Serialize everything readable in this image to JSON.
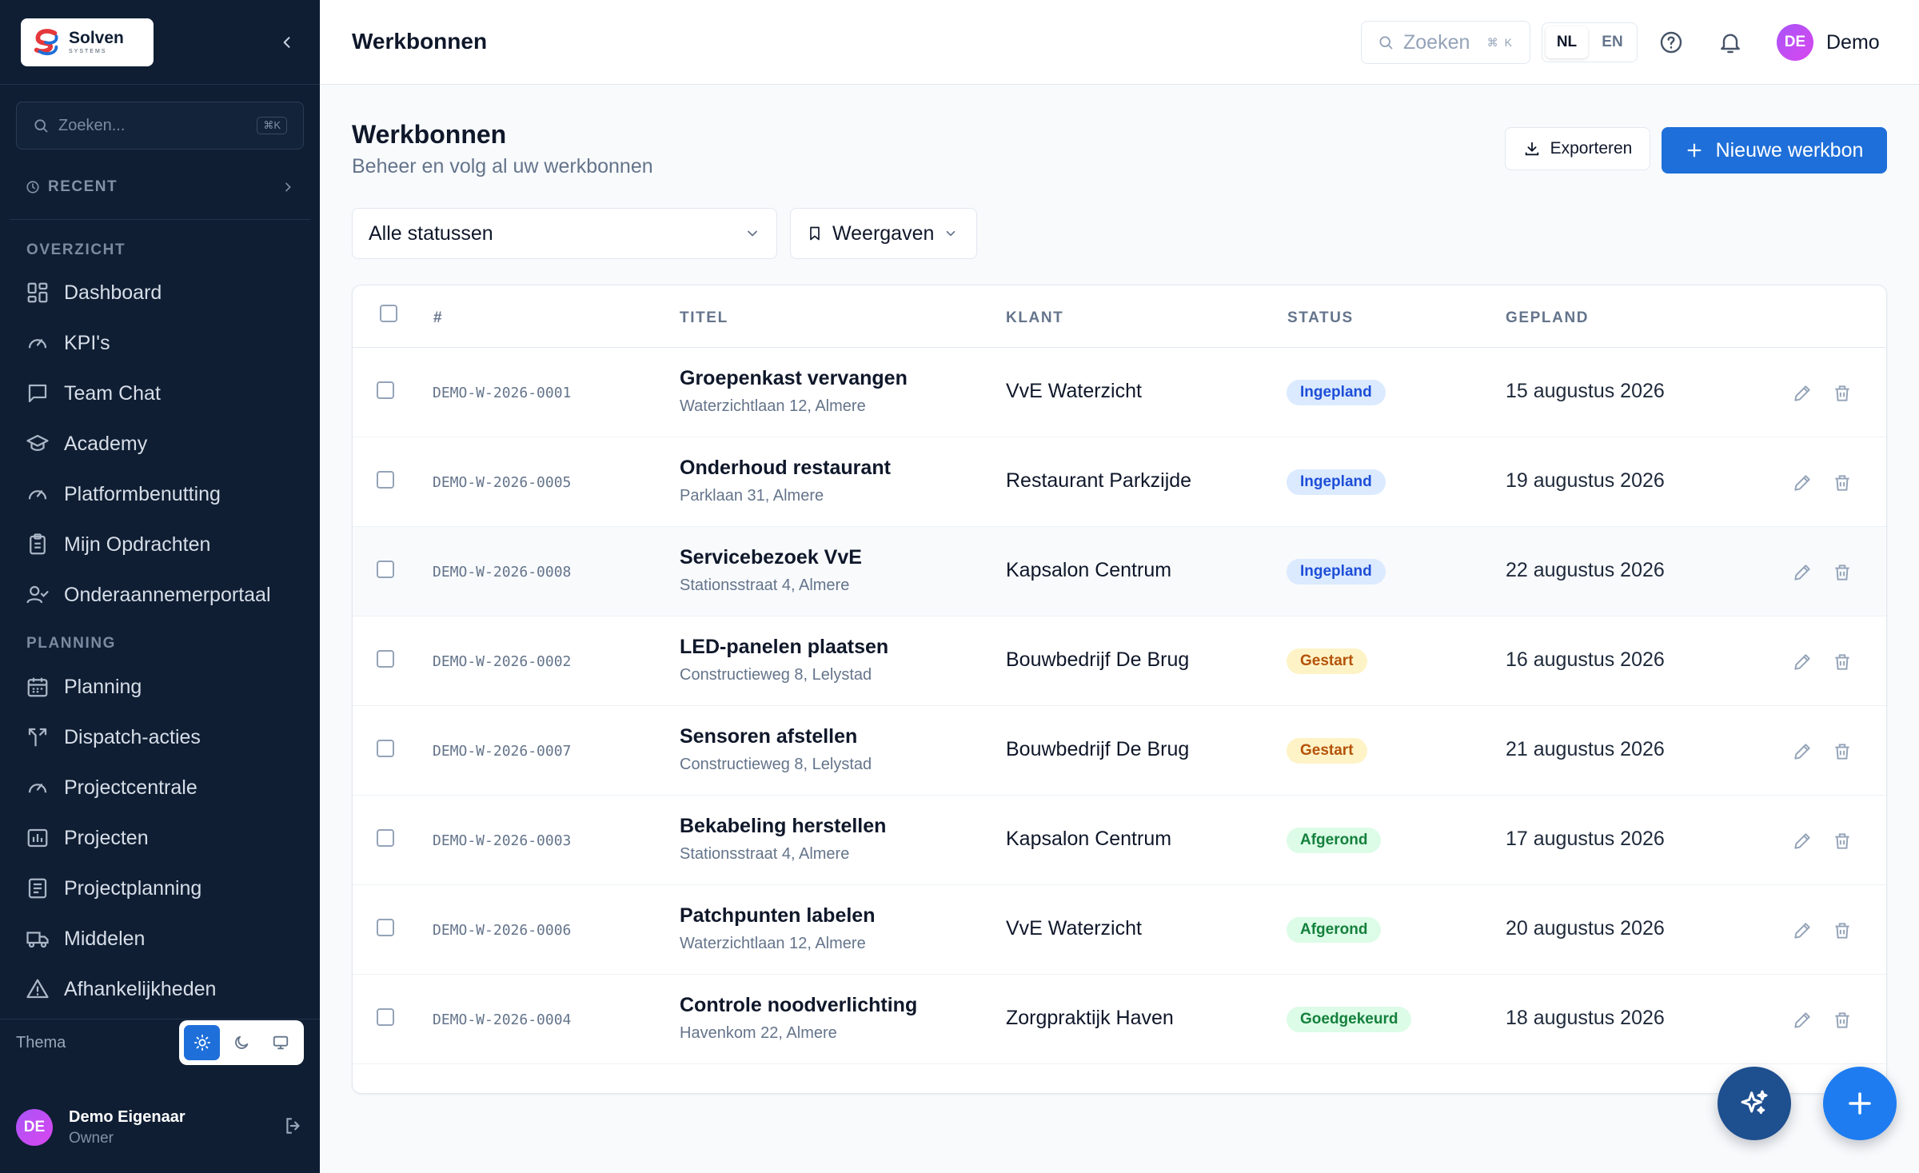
{
  "sidebar": {
    "logo": {
      "name": "Solven",
      "tagline": "SYSTEMS"
    },
    "search": {
      "placeholder": "Zoeken...",
      "shortcut": "⌘K"
    },
    "recent_label": "RECENT",
    "sections": [
      {
        "label": "OVERZICHT",
        "items": [
          {
            "label": "Dashboard",
            "icon": "grid-icon"
          },
          {
            "label": "KPI's",
            "icon": "gauge-icon"
          },
          {
            "label": "Team Chat",
            "icon": "chat-icon"
          },
          {
            "label": "Academy",
            "icon": "graduation-cap-icon"
          },
          {
            "label": "Platformbenutting",
            "icon": "gauge-icon"
          },
          {
            "label": "Mijn Opdrachten",
            "icon": "clipboard-icon"
          },
          {
            "label": "Onderaannemerportaal",
            "icon": "user-check-icon"
          }
        ]
      },
      {
        "label": "PLANNING",
        "items": [
          {
            "label": "Planning",
            "icon": "calendar-icon"
          },
          {
            "label": "Dispatch-acties",
            "icon": "split-arrow-icon"
          },
          {
            "label": "Projectcentrale",
            "icon": "gauge-icon"
          },
          {
            "label": "Projecten",
            "icon": "chart-icon"
          },
          {
            "label": "Projectplanning",
            "icon": "list-icon"
          },
          {
            "label": "Middelen",
            "icon": "truck-icon"
          },
          {
            "label": "Afhankelijkheden",
            "icon": "warning-icon"
          }
        ]
      }
    ],
    "theme": {
      "label": "Thema",
      "options": [
        "light",
        "dark",
        "system"
      ],
      "selected": "light"
    },
    "user": {
      "initials": "DE",
      "name": "Demo Eigenaar",
      "role": "Owner"
    }
  },
  "header": {
    "title": "Werkbonnen",
    "search": {
      "placeholder": "Zoeken",
      "shortcut": "⌘ K"
    },
    "languages": [
      "NL",
      "EN"
    ],
    "active_language": "NL",
    "user": {
      "initials": "DE",
      "name": "Demo"
    }
  },
  "page": {
    "title": "Werkbonnen",
    "subtitle": "Beheer en volg al uw werkbonnen",
    "export_label": "Exporteren",
    "new_label": "Nieuwe werkbon",
    "status_filter": "Alle statussen",
    "views_label": "Weergaven"
  },
  "table": {
    "columns": [
      "#",
      "TITEL",
      "KLANT",
      "STATUS",
      "GEPLAND"
    ],
    "rows": [
      {
        "id": "DEMO-W-2026-0001",
        "title": "Groepenkast vervangen",
        "address": "Waterzichtlaan 12, Almere",
        "client": "VvE Waterzicht",
        "status": "Ingepland",
        "date": "15 augustus 2026"
      },
      {
        "id": "DEMO-W-2026-0005",
        "title": "Onderhoud restaurant",
        "address": "Parklaan 31, Almere",
        "client": "Restaurant Parkzijde",
        "status": "Ingepland",
        "date": "19 augustus 2026"
      },
      {
        "id": "DEMO-W-2026-0008",
        "title": "Servicebezoek VvE",
        "address": "Stationsstraat 4, Almere",
        "client": "Kapsalon Centrum",
        "status": "Ingepland",
        "date": "22 augustus 2026"
      },
      {
        "id": "DEMO-W-2026-0002",
        "title": "LED-panelen plaatsen",
        "address": "Constructieweg 8, Lelystad",
        "client": "Bouwbedrijf De Brug",
        "status": "Gestart",
        "date": "16 augustus 2026"
      },
      {
        "id": "DEMO-W-2026-0007",
        "title": "Sensoren afstellen",
        "address": "Constructieweg 8, Lelystad",
        "client": "Bouwbedrijf De Brug",
        "status": "Gestart",
        "date": "21 augustus 2026"
      },
      {
        "id": "DEMO-W-2026-0003",
        "title": "Bekabeling herstellen",
        "address": "Stationsstraat 4, Almere",
        "client": "Kapsalon Centrum",
        "status": "Afgerond",
        "date": "17 augustus 2026"
      },
      {
        "id": "DEMO-W-2026-0006",
        "title": "Patchpunten labelen",
        "address": "Waterzichtlaan 12, Almere",
        "client": "VvE Waterzicht",
        "status": "Afgerond",
        "date": "20 augustus 2026"
      },
      {
        "id": "DEMO-W-2026-0004",
        "title": "Controle noodverlichting",
        "address": "Havenkom 22, Almere",
        "client": "Zorgpraktijk Haven",
        "status": "Goedgekeurd",
        "date": "18 augustus 2026"
      }
    ]
  },
  "status_colors": {
    "Ingepland": {
      "bg": "#dbeafe",
      "fg": "#1d4ed8"
    },
    "Gestart": {
      "bg": "#fef3c7",
      "fg": "#b45309"
    },
    "Afgerond": {
      "bg": "#dcfce7",
      "fg": "#15803d"
    },
    "Goedgekeurd": {
      "bg": "#dcfce7",
      "fg": "#15803d"
    }
  },
  "colors": {
    "accent": "#1e6fd9",
    "sidebar": "#0f1e33",
    "ai_fab": "#1e4f8f"
  },
  "fabs": [
    {
      "icon": "sparkles-icon"
    },
    {
      "icon": "plus-icon"
    }
  ]
}
